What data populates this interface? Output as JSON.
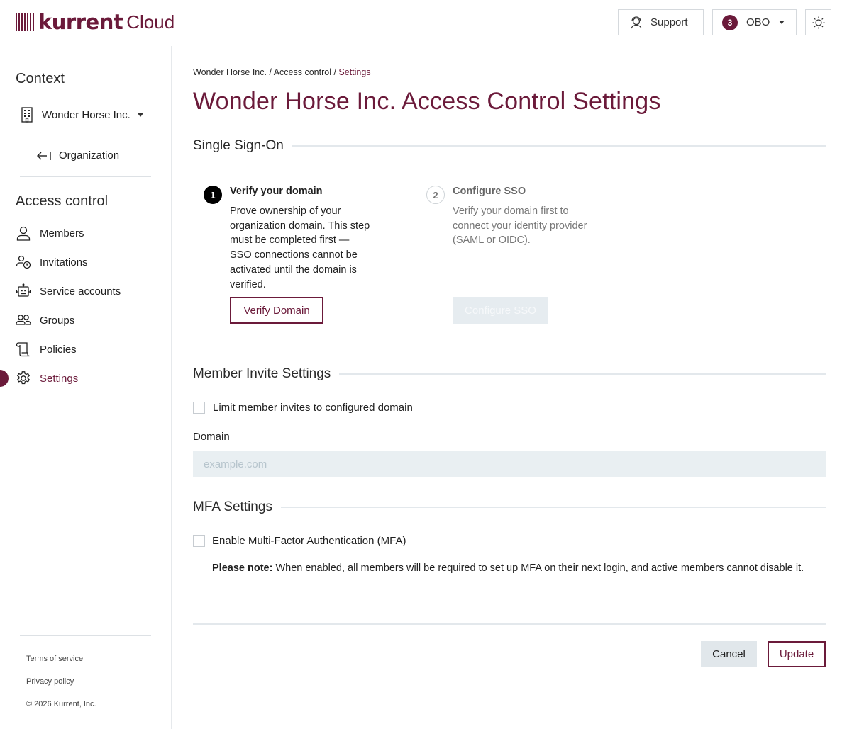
{
  "header": {
    "brand": "kurrent",
    "product": "Cloud",
    "support_label": "Support",
    "org_badge": "3",
    "org_label": "OBO",
    "icons": {
      "support": "headset-icon",
      "theme": "sun-icon",
      "logo": "kurrent-bars-logo"
    }
  },
  "sidebar": {
    "context_heading": "Context",
    "context_value": "Wonder Horse Inc.",
    "back_label": "Organization",
    "section_heading": "Access control",
    "items": [
      {
        "label": "Members",
        "icon": "user-icon"
      },
      {
        "label": "Invitations",
        "icon": "user-clock-icon"
      },
      {
        "label": "Service accounts",
        "icon": "robot-icon"
      },
      {
        "label": "Groups",
        "icon": "users-icon"
      },
      {
        "label": "Policies",
        "icon": "scroll-icon"
      },
      {
        "label": "Settings",
        "icon": "gear-icon",
        "active": true
      }
    ],
    "footer": {
      "terms": "Terms of service",
      "privacy": "Privacy policy",
      "copyright": "© 2026 Kurrent, Inc."
    }
  },
  "main": {
    "breadcrumb": {
      "part1": "Wonder Horse Inc.",
      "part2": "Access control",
      "current": "Settings",
      "sep": " / "
    },
    "title": "Wonder Horse Inc. Access Control Settings",
    "sso": {
      "heading": "Single Sign-On",
      "step1": {
        "num": "1",
        "title": "Verify your domain",
        "desc_lines": [
          "Prove ownership of your",
          "organization domain. This step",
          "must be completed first —",
          "SSO connections cannot be",
          "activated until the domain is",
          "verified."
        ],
        "button": "Verify Domain"
      },
      "step2": {
        "num": "2",
        "title": "Configure SSO",
        "desc_lines": [
          "Verify your domain first to",
          "connect your identity provider",
          "(SAML or OIDC)."
        ],
        "button": "Configure SSO"
      }
    },
    "invite": {
      "heading": "Member Invite Settings",
      "checkbox_label": "Limit member invites to configured domain",
      "checked": false,
      "domain_label": "Domain",
      "domain_placeholder": "example.com",
      "domain_value": ""
    },
    "mfa": {
      "heading": "MFA Settings",
      "checkbox_label": "Enable Multi-Factor Authentication (MFA)",
      "checked": false,
      "note_bold": "Please note:",
      "note_text": " When enabled, all members will be required to set up MFA on their next login, and active members cannot disable it."
    },
    "actions": {
      "cancel": "Cancel",
      "update": "Update"
    }
  },
  "colors": {
    "brand": "#6b1a3a",
    "divider": "#e3e8ec",
    "input_bg": "#e9eff2"
  }
}
